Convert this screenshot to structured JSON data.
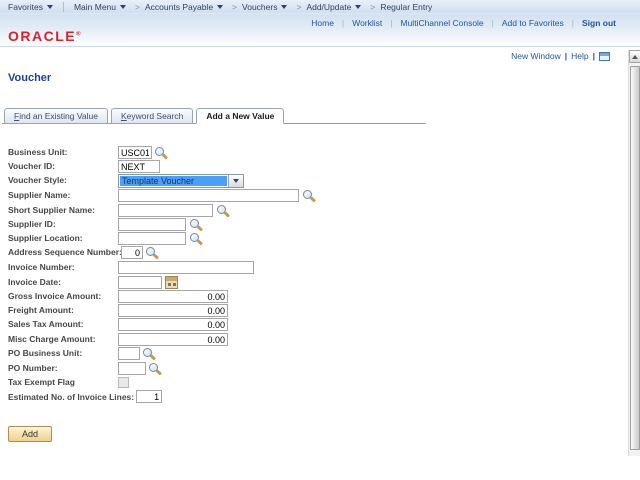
{
  "header": {
    "favorites_label": "Favorites",
    "main_menu_label": "Main Menu",
    "breadcrumbs": [
      "Accounts Payable",
      "Vouchers",
      "Add/Update",
      "Regular Entry"
    ],
    "utility_links": {
      "home": "Home",
      "worklist": "Worklist",
      "multichannel": "MultiChannel Console",
      "add_to_favorites": "Add to Favorites",
      "sign_out": "Sign out"
    },
    "logo_text": "ORACLE"
  },
  "page": {
    "title": "Voucher",
    "new_window_label": "New Window",
    "help_label": "Help"
  },
  "tabs": {
    "find": {
      "accesskey": "F",
      "rest": "ind an Existing Value"
    },
    "keyword": {
      "accesskey": "K",
      "rest": "eyword Search"
    },
    "add": {
      "label": "Add a New Value"
    }
  },
  "form": {
    "fields": {
      "business_unit": {
        "label": "Business Unit:",
        "value": "USC01"
      },
      "voucher_id": {
        "label": "Voucher ID:",
        "value": "NEXT"
      },
      "voucher_style": {
        "label": "Voucher Style:",
        "value": "Template Voucher"
      },
      "supplier_name": {
        "label": "Supplier Name:",
        "value": ""
      },
      "short_supplier_name": {
        "label": "Short Supplier Name:",
        "value": ""
      },
      "supplier_id": {
        "label": "Supplier ID:",
        "value": ""
      },
      "supplier_location": {
        "label": "Supplier Location:",
        "value": ""
      },
      "address_sequence_number": {
        "label": "Address Sequence Number:",
        "value": "0"
      },
      "invoice_number": {
        "label": "Invoice Number:",
        "value": ""
      },
      "invoice_date": {
        "label": "Invoice Date:",
        "value": ""
      },
      "gross_invoice_amount": {
        "label": "Gross Invoice Amount:",
        "value": "0.00"
      },
      "freight_amount": {
        "label": "Freight Amount:",
        "value": "0.00"
      },
      "sales_tax_amount": {
        "label": "Sales Tax Amount:",
        "value": "0.00"
      },
      "misc_charge_amount": {
        "label": "Misc Charge Amount:",
        "value": "0.00"
      },
      "po_business_unit": {
        "label": "PO Business Unit:",
        "value": ""
      },
      "po_number": {
        "label": "PO Number:",
        "value": ""
      },
      "tax_exempt_flag": {
        "label": "Tax Exempt Flag",
        "checked": false
      },
      "estimated_invoice_lines": {
        "label": "Estimated No. of Invoice Lines:",
        "value": "1"
      }
    },
    "add_button_label": "Add"
  },
  "colors": {
    "brand_red": "#e21e26",
    "title_blue": "#1c3f9a",
    "link_blue": "#23559c",
    "selection_blue": "#4aa0f8",
    "button_tan": "#f2d08c"
  }
}
